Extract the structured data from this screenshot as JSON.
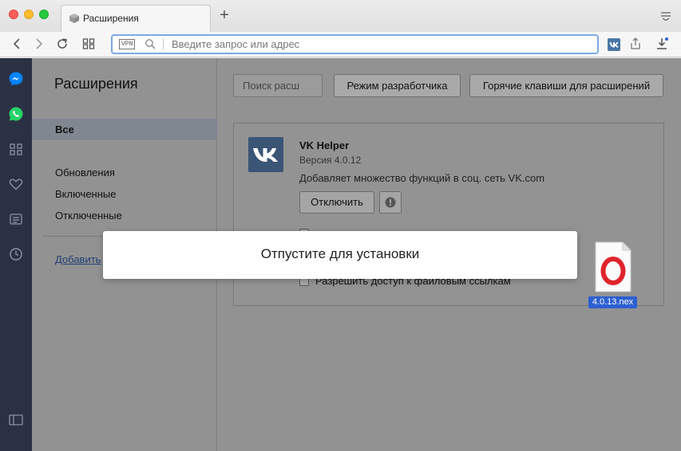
{
  "tab": {
    "title": "Расширения"
  },
  "address_bar": {
    "vpn_badge": "VPN",
    "placeholder": "Введите запрос или адрес"
  },
  "page": {
    "title": "Расширения",
    "nav": {
      "all": "Все",
      "updates": "Обновления",
      "enabled": "Включенные",
      "disabled": "Отключенные",
      "add_link": "Добавить"
    },
    "buttons": {
      "search_placeholder": "Поиск расш",
      "dev_mode": "Режим разработчика",
      "hotkeys": "Горячие клавиши для расширений"
    },
    "extension": {
      "name": "VK Helper",
      "version": "Версия 4.0.12",
      "description": "Добавляет множество функций в соц. сеть VK.com",
      "disable_label": "Отключить",
      "file_access_label": "Разрешить доступ к файловым ссылкам"
    }
  },
  "drop_overlay": {
    "text": "Отпустите для установки"
  },
  "dragged_file": {
    "name": "4.0.13.nex"
  },
  "colors": {
    "sidebar_bg": "#2b3144",
    "vk_blue": "#3b5576",
    "opera_red": "#e0232b",
    "selection_blue": "#2c5fd1"
  }
}
